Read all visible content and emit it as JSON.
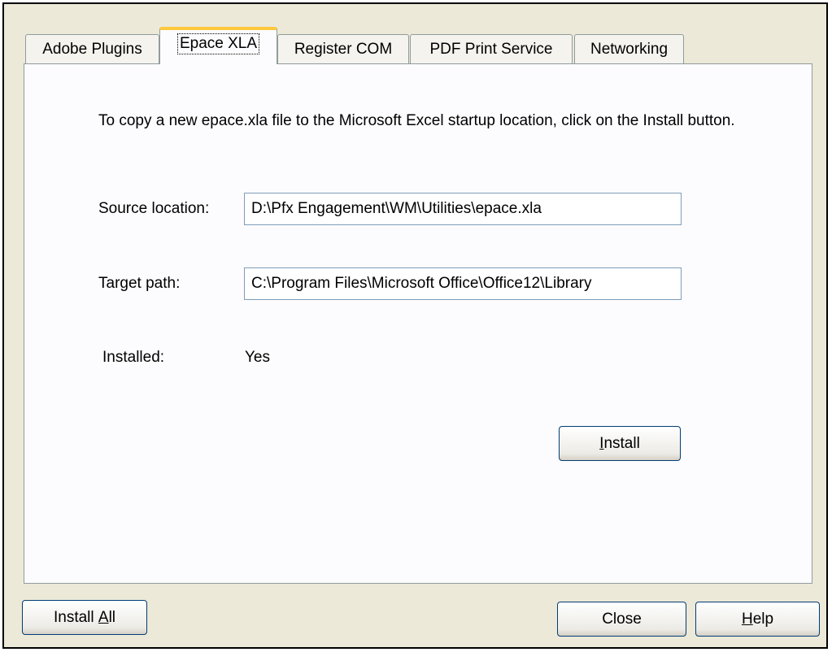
{
  "tabs": [
    {
      "label": "Adobe Plugins"
    },
    {
      "label": "Epace XLA"
    },
    {
      "label": "Register COM"
    },
    {
      "label": "PDF Print Service"
    },
    {
      "label": "Networking"
    }
  ],
  "active_tab": "Epace XLA",
  "panel": {
    "description": "To copy a new epace.xla file to the Microsoft Excel startup location, click on the Install button.",
    "source_label": "Source location:",
    "source_value": "D:\\Pfx Engagement\\WM\\Utilities\\epace.xla",
    "target_label": "Target path:",
    "target_value": "C:\\Program Files\\Microsoft Office\\Office12\\Library",
    "installed_label": "Installed:",
    "installed_value": "Yes",
    "install_button": {
      "underlined": "I",
      "rest": "nstall"
    }
  },
  "footer": {
    "install_all_button": {
      "prefix": "Install ",
      "underlined": "A",
      "rest": "ll"
    },
    "close_button": "Close",
    "help_button": {
      "underlined": "H",
      "rest": "elp"
    }
  },
  "colors": {
    "dialog_bg": "#ece9d8",
    "panel_bg": "#fcfcfe",
    "active_tab_accent": "#ffc83c",
    "button_border": "#003c74",
    "textbox_border": "#7f9db9"
  }
}
